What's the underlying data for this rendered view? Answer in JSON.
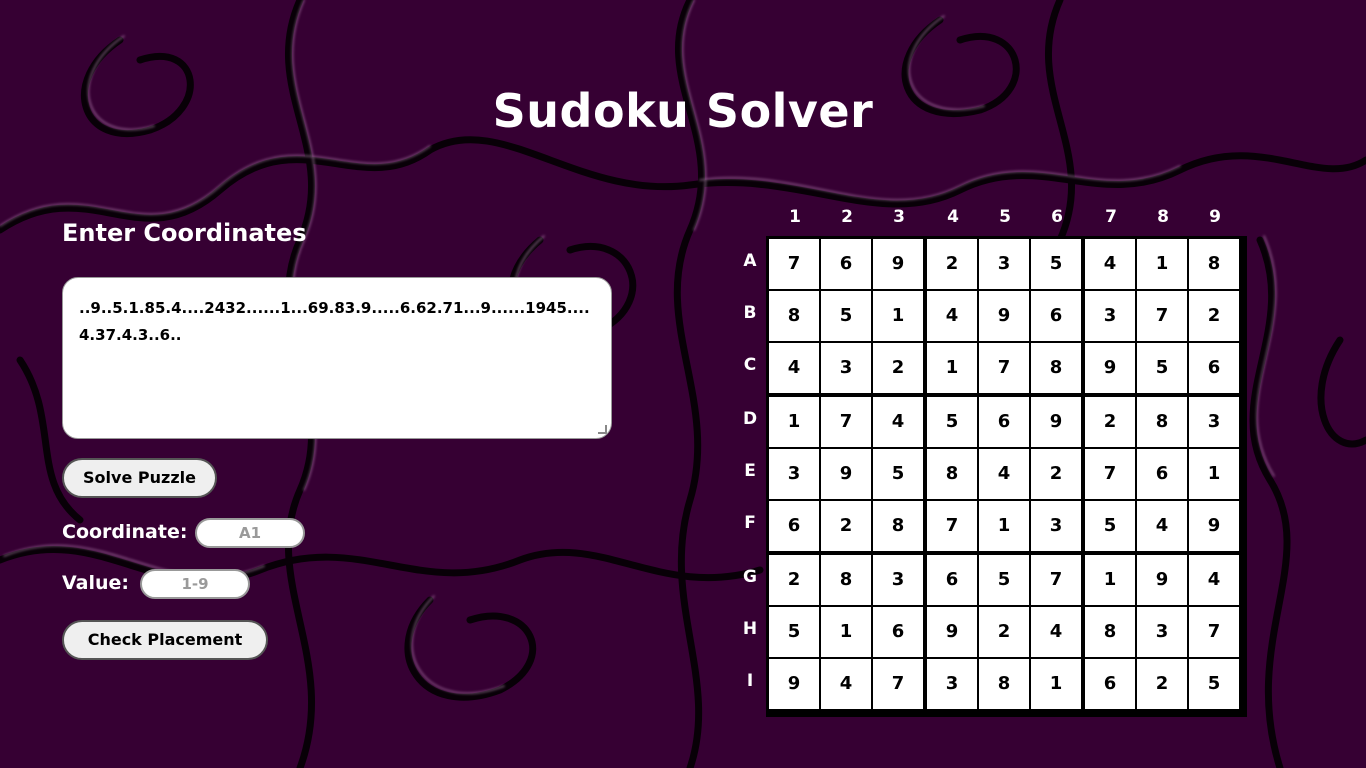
{
  "title": "Sudoku Solver",
  "left": {
    "heading": "Enter Coordinates",
    "puzzle_text": "..9..5.1.85.4....2432......1...69.83.9.....6.62.71...9......1945....4.37.4.3..6..",
    "solve_button": "Solve Puzzle",
    "coordinate_label": "Coordinate:",
    "coordinate_placeholder": "A1",
    "value_label": "Value:",
    "value_placeholder": "1-9",
    "check_button": "Check Placement"
  },
  "board": {
    "columns": [
      "1",
      "2",
      "3",
      "4",
      "5",
      "6",
      "7",
      "8",
      "9"
    ],
    "rows": [
      "A",
      "B",
      "C",
      "D",
      "E",
      "F",
      "G",
      "H",
      "I"
    ],
    "cells": [
      [
        "7",
        "6",
        "9",
        "2",
        "3",
        "5",
        "4",
        "1",
        "8"
      ],
      [
        "8",
        "5",
        "1",
        "4",
        "9",
        "6",
        "3",
        "7",
        "2"
      ],
      [
        "4",
        "3",
        "2",
        "1",
        "7",
        "8",
        "9",
        "5",
        "6"
      ],
      [
        "1",
        "7",
        "4",
        "5",
        "6",
        "9",
        "2",
        "8",
        "3"
      ],
      [
        "3",
        "9",
        "5",
        "8",
        "4",
        "2",
        "7",
        "6",
        "1"
      ],
      [
        "6",
        "2",
        "8",
        "7",
        "1",
        "3",
        "5",
        "4",
        "9"
      ],
      [
        "2",
        "8",
        "3",
        "6",
        "5",
        "7",
        "1",
        "9",
        "4"
      ],
      [
        "5",
        "1",
        "6",
        "9",
        "2",
        "4",
        "8",
        "3",
        "7"
      ],
      [
        "9",
        "4",
        "7",
        "3",
        "8",
        "1",
        "6",
        "2",
        "5"
      ]
    ]
  },
  "colors": {
    "background": "#360033",
    "text": "#ffffff",
    "cell": "#ffffff",
    "grid_lines": "#000000"
  }
}
